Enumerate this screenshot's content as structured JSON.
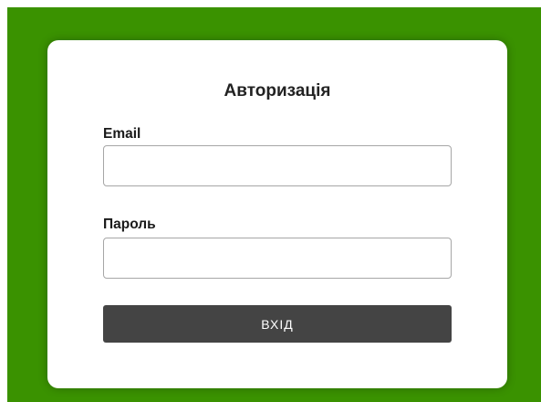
{
  "login_form": {
    "title": "Авторизація",
    "email": {
      "label": "Email",
      "value": "",
      "placeholder": ""
    },
    "password": {
      "label": "Пароль",
      "value": "",
      "placeholder": ""
    },
    "submit_label": "ВХІД"
  },
  "colors": {
    "background_green": "#3a9200",
    "card_background": "#ffffff",
    "button_background": "#444444",
    "button_text": "#ffffff",
    "input_border": "#a6a6a6"
  }
}
